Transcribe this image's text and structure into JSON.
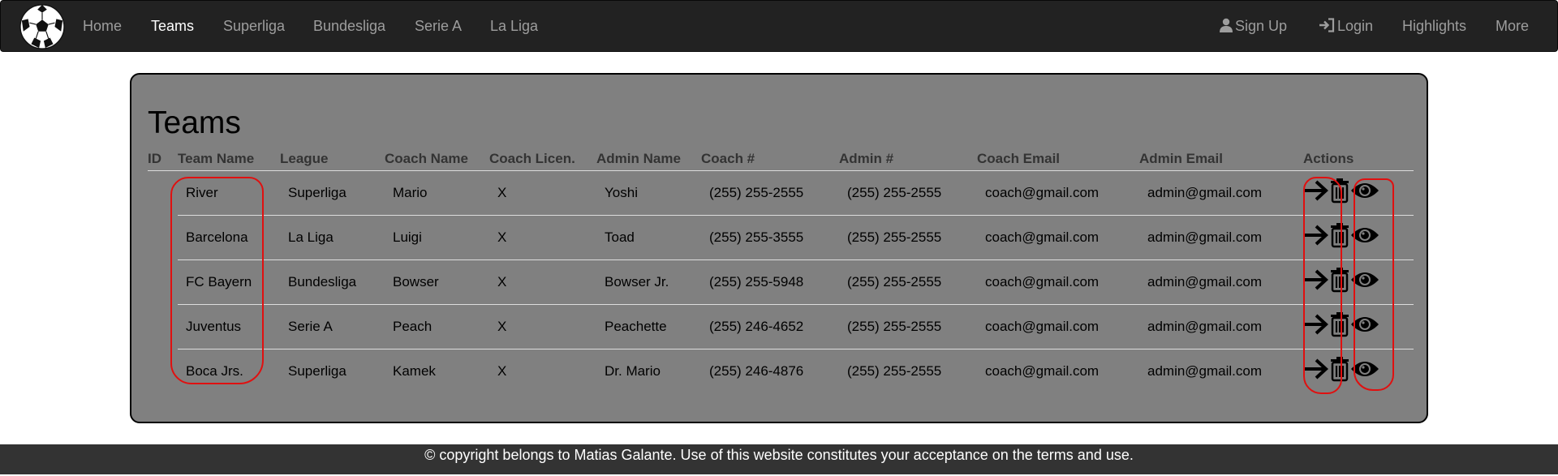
{
  "nav": {
    "items": [
      {
        "label": "Home",
        "active": false
      },
      {
        "label": "Teams",
        "active": true
      },
      {
        "label": "Superliga",
        "active": false
      },
      {
        "label": "Bundesliga",
        "active": false
      },
      {
        "label": "Serie A",
        "active": false
      },
      {
        "label": "La Liga",
        "active": false
      }
    ],
    "right": {
      "signup": "Sign Up",
      "login": "Login",
      "highlights": "Highlights",
      "more": "More"
    }
  },
  "page": {
    "title": "Teams"
  },
  "table": {
    "headers": [
      "ID",
      "Team Name",
      "League",
      "Coach Name",
      "Coach Licen.",
      "Admin Name",
      "Coach #",
      "Admin #",
      "Coach Email",
      "Admin Email",
      "Actions"
    ],
    "rows": [
      [
        "",
        "River",
        "Superliga",
        "Mario",
        "X",
        "Yoshi",
        "(255) 255-2555",
        "(255) 255-2555",
        "coach@gmail.com",
        "admin@gmail.com"
      ],
      [
        "",
        "Barcelona",
        "La Liga",
        "Luigi",
        "X",
        "Toad",
        "(255) 255-3555",
        "(255) 255-2555",
        "coach@gmail.com",
        "admin@gmail.com"
      ],
      [
        "",
        "FC Bayern",
        "Bundesliga",
        "Bowser",
        "X",
        "Bowser Jr.",
        "(255) 255-5948",
        "(255) 255-2555",
        "coach@gmail.com",
        "admin@gmail.com"
      ],
      [
        "",
        "Juventus",
        "Serie A",
        "Peach",
        "X",
        "Peachette",
        "(255) 246-4652",
        "(255) 255-2555",
        "coach@gmail.com",
        "admin@gmail.com"
      ],
      [
        "",
        "Boca Jrs.",
        "Superliga",
        "Kamek",
        "X",
        "Dr. Mario",
        "(255) 246-4876",
        "(255) 255-2555",
        "coach@gmail.com",
        "admin@gmail.com"
      ]
    ],
    "actions": [
      "arrow-right-icon",
      "trash-icon",
      "eye-icon"
    ]
  },
  "footer": {
    "text": "© copyright belongs to Matias Galante. Use of this website constitutes your acceptance on the terms and use."
  },
  "colors": {
    "navbar": "#222222",
    "panel": "#808080",
    "annotation": "#e01010",
    "footer": "#333333"
  }
}
